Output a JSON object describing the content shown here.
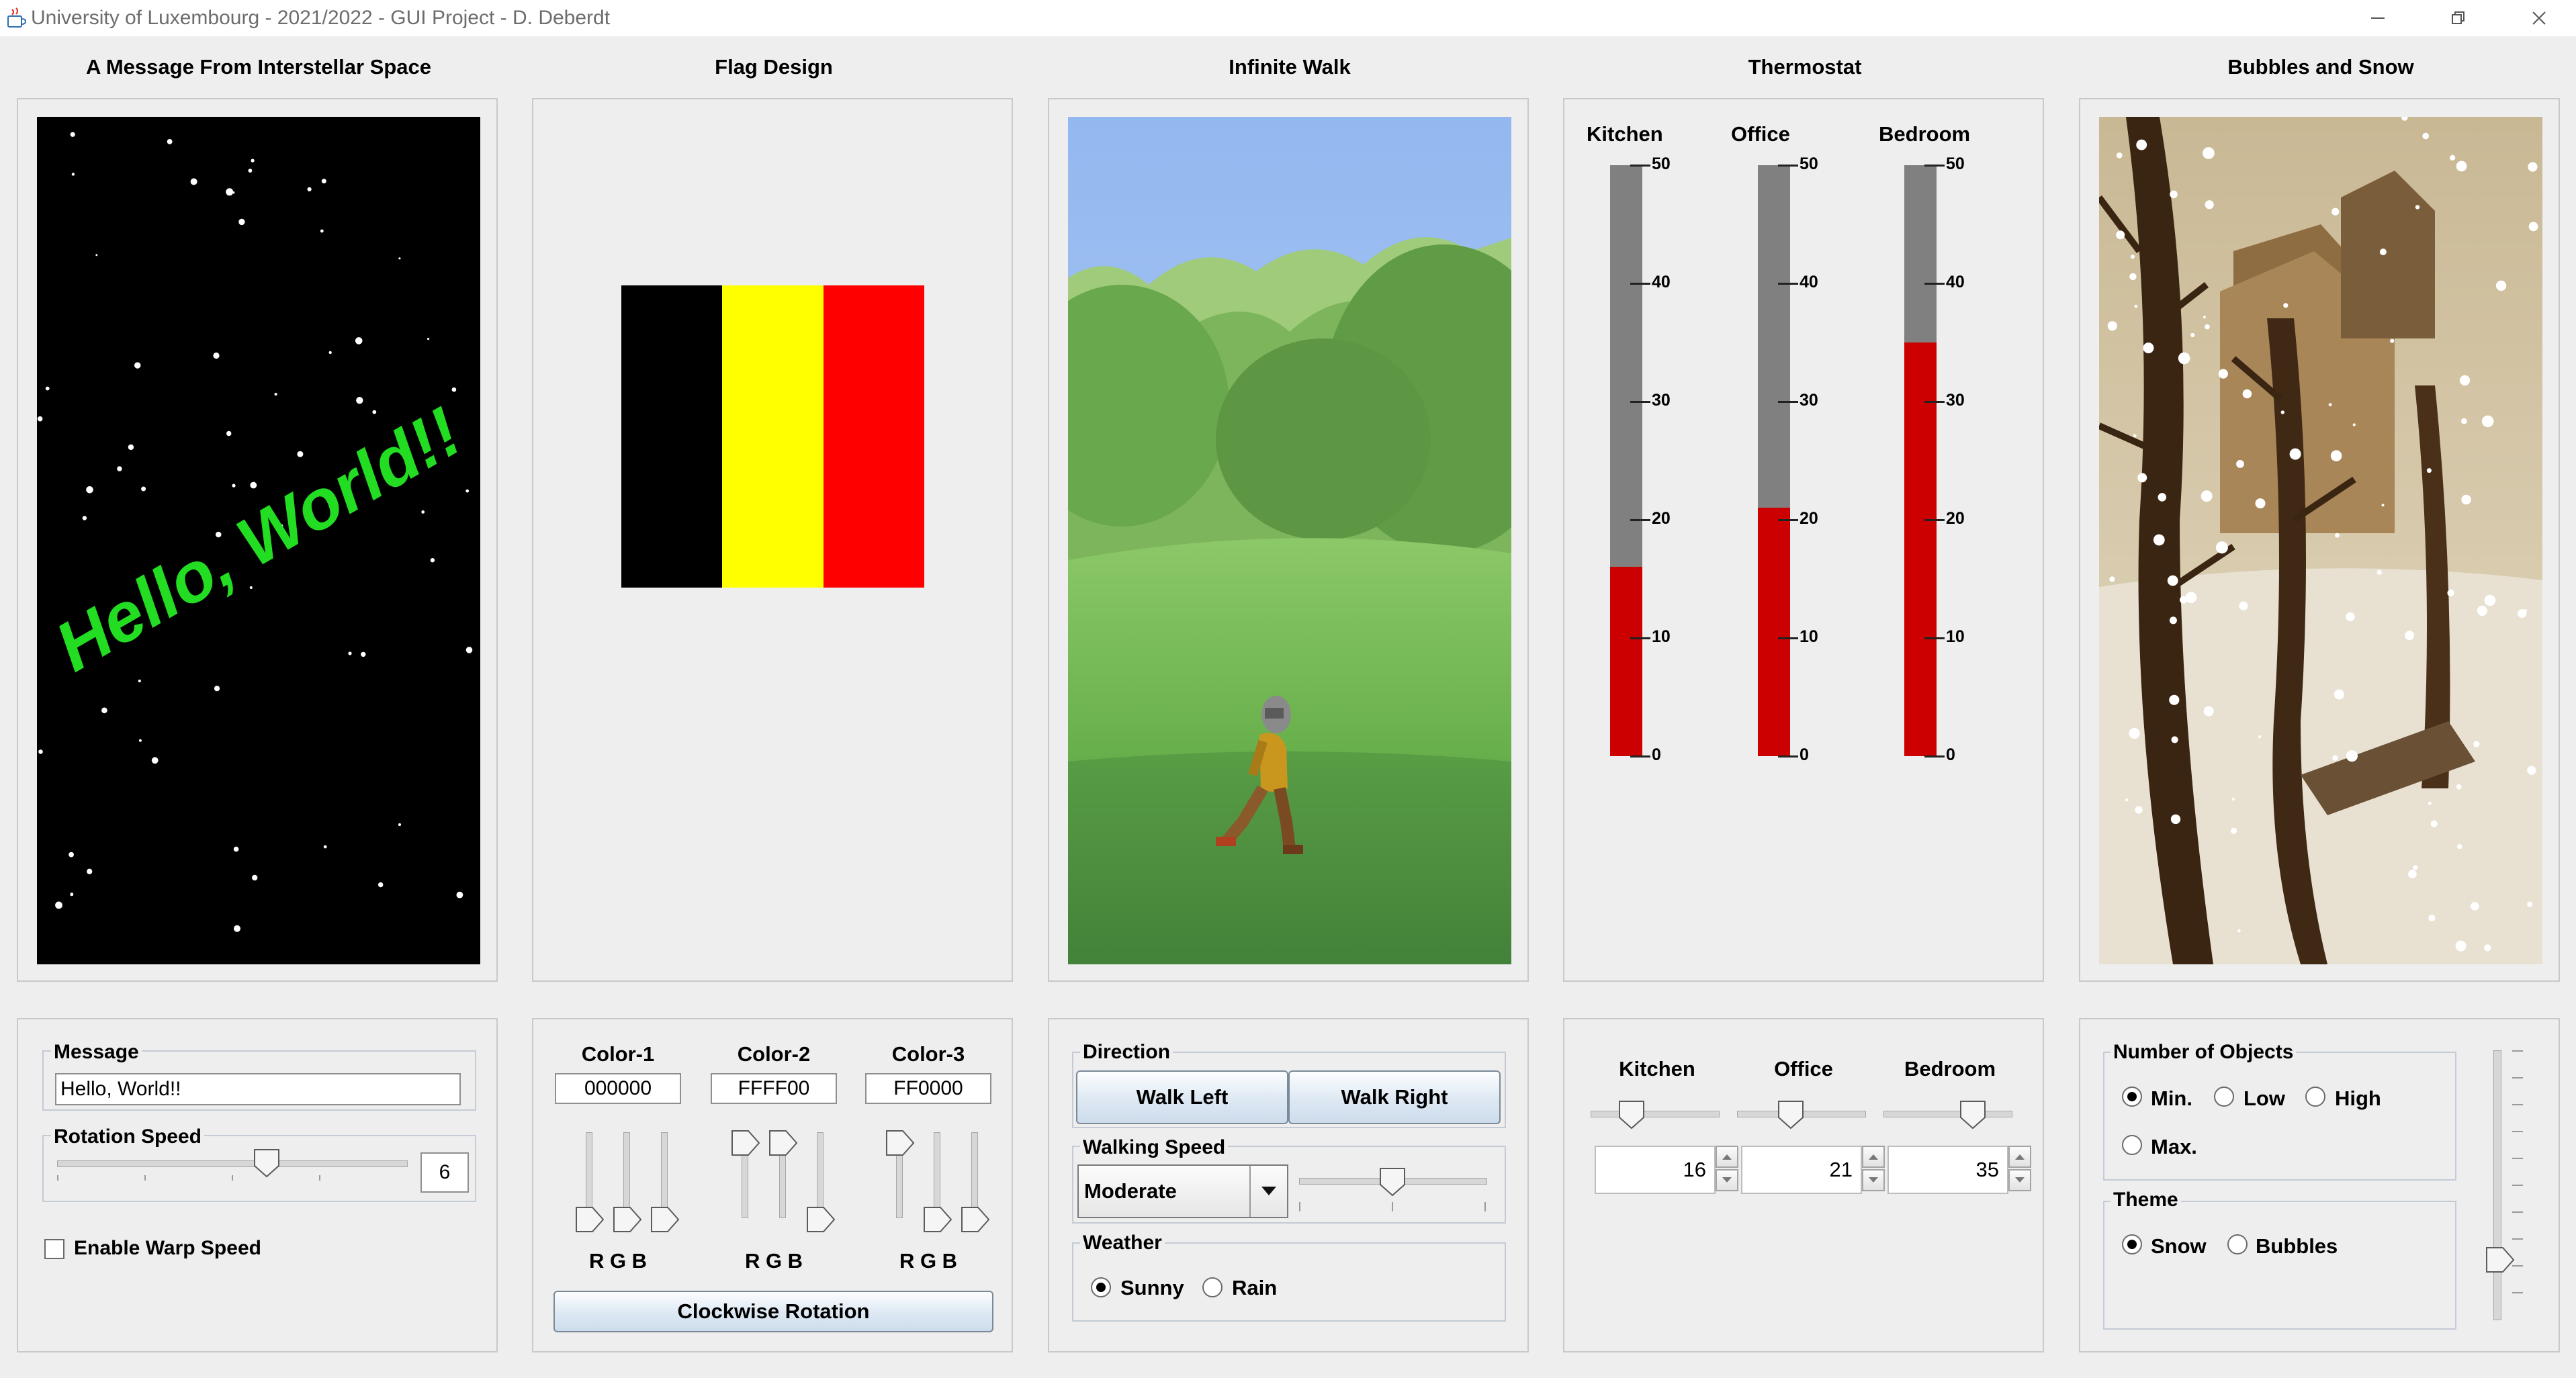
{
  "window": {
    "title": "University of Luxembourg - 2021/2022 - GUI Project - D. Deberdt"
  },
  "panels": {
    "message": {
      "title": "A Message From Interstellar Space",
      "display_text": "Hello, World!!"
    },
    "flag": {
      "title": "Flag Design"
    },
    "walk": {
      "title": "Infinite Walk"
    },
    "thermostat": {
      "title": "Thermostat"
    },
    "bubbles": {
      "title": "Bubbles and Snow"
    }
  },
  "message_controls": {
    "message_label": "Message",
    "message_value": "Hello, World!!",
    "rotation_label": "Rotation Speed",
    "rotation_value": "6",
    "rotation_fraction": 0.6,
    "warp_label": "Enable Warp Speed",
    "warp_checked": false
  },
  "flag_colors": [
    {
      "label": "Color-1",
      "hex": "000000",
      "rgb_label": "R G B",
      "rgb": [
        0,
        0,
        0
      ],
      "color": "#000000"
    },
    {
      "label": "Color-2",
      "hex": "FFFF00",
      "rgb_label": "R G B",
      "rgb": [
        255,
        255,
        0
      ],
      "color": "#FFFF00"
    },
    {
      "label": "Color-3",
      "hex": "FF0000",
      "rgb_label": "R G B",
      "rgb": [
        255,
        0,
        0
      ],
      "color": "#FF0000"
    }
  ],
  "flag_controls": {
    "rotate_button": "Clockwise Rotation"
  },
  "walk_controls": {
    "direction_label": "Direction",
    "walk_left": "Walk Left",
    "walk_right": "Walk Right",
    "speed_label": "Walking Speed",
    "speed_option": "Moderate",
    "speed_fraction": 0.5,
    "weather_label": "Weather",
    "weather_options": [
      "Sunny",
      "Rain"
    ],
    "weather_selected": "Sunny"
  },
  "thermostat": {
    "max": 50,
    "ticks": [
      "50",
      "40",
      "30",
      "20",
      "10",
      "0"
    ],
    "rooms": [
      {
        "name": "Kitchen",
        "value": 16,
        "value_text": "16"
      },
      {
        "name": "Office",
        "value": 21,
        "value_text": "21"
      },
      {
        "name": "Bedroom",
        "value": 35,
        "value_text": "35"
      }
    ],
    "fill_color": "#cc0000",
    "empty_color": "#808080"
  },
  "bubbles_controls": {
    "objects_label": "Number of Objects",
    "objects_options": [
      "Min.",
      "Low",
      "High",
      "Max."
    ],
    "objects_selected": "Min.",
    "theme_label": "Theme",
    "theme_options": [
      "Snow",
      "Bubbles"
    ],
    "theme_selected": "Snow",
    "vertical_slider_fraction": 0.22
  }
}
